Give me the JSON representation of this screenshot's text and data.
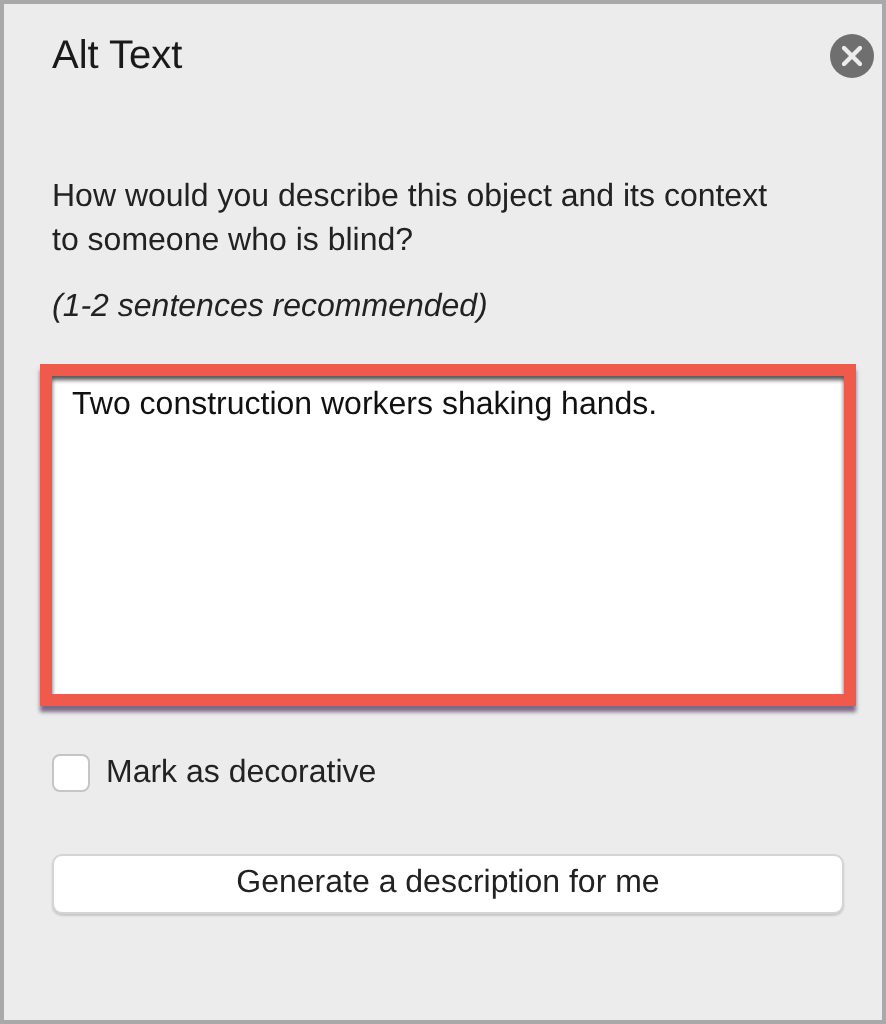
{
  "panel": {
    "title": "Alt Text"
  },
  "prompt": "How would you describe this object and its context to someone who is blind?",
  "hint": "(1-2 sentences recommended)",
  "description_field": {
    "value": "Two construction workers shaking hands.",
    "highlighted": true
  },
  "decorative_checkbox": {
    "label": "Mark as decorative",
    "checked": false
  },
  "generate_button": {
    "label": "Generate a description for me"
  }
}
